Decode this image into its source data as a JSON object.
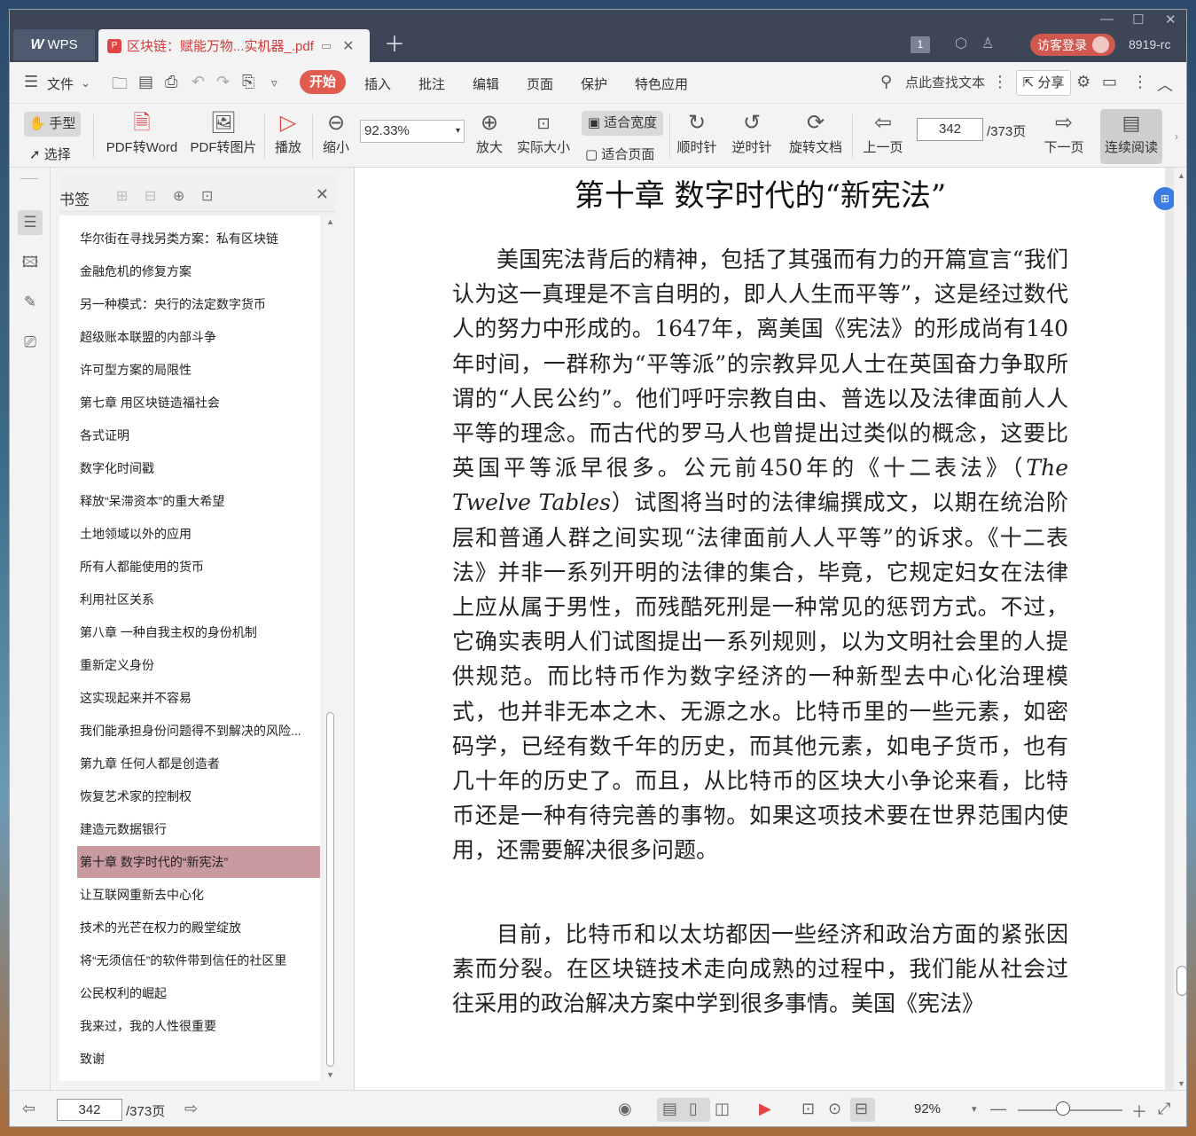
{
  "titlebar": {
    "app_name": "WPS",
    "doc_tab_title": "区块链：赋能万物...实机器_.pdf",
    "badge_count": "1",
    "login_label": "访客登录",
    "user_id": "8919-rc"
  },
  "menubar": {
    "file": "文件",
    "tabs": [
      "开始",
      "插入",
      "批注",
      "编辑",
      "页面",
      "保护",
      "特色应用"
    ],
    "search_placeholder": "点此查找文本",
    "share": "分享"
  },
  "toolbar": {
    "hand": "手型",
    "select": "选择",
    "pdf_to_word": "PDF转Word",
    "pdf_to_image": "PDF转图片",
    "play": "播放",
    "zoom_out": "缩小",
    "zoom_value": "92.33%",
    "zoom_in": "放大",
    "actual_size": "实际大小",
    "fit_width": "适合宽度",
    "fit_page": "适合页面",
    "clockwise": "顺时针",
    "counterclockwise": "逆时针",
    "rotate_doc": "旋转文档",
    "prev_page": "上一页",
    "page_current": "342",
    "page_total": "/373页",
    "next_page": "下一页",
    "continuous": "连续阅读"
  },
  "bookmarks": {
    "title": "书签",
    "items": [
      "华尔街在寻找另类方案：私有区块链",
      "金融危机的修复方案",
      "另一种模式：央行的法定数字货币",
      "超级账本联盟的内部斗争",
      "许可型方案的局限性",
      "第七章 用区块链造福社会",
      "各式证明",
      "数字化时间戳",
      "释放“呆滞资本”的重大希望",
      "土地领域以外的应用",
      "所有人都能使用的货币",
      "利用社区关系",
      "第八章 一种自我主权的身份机制",
      "重新定义身份",
      "这实现起来并不容易",
      "我们能承担身份问题得不到解决的风险...",
      "第九章 任何人都是创造者",
      "恢复艺术家的控制权",
      "建造元数据银行",
      "第十章 数字时代的“新宪法”",
      "让互联网重新去中心化",
      "技术的光芒在权力的殿堂绽放",
      "将“无须信任”的软件带到信任的社区里",
      "公民权利的崛起",
      "我来过，我的人性很重要",
      "致谢"
    ],
    "selected_index": 19
  },
  "document": {
    "chapter_title": "第十章 数字时代的“新宪法”",
    "para1_part1": "美国宪法背后的精神，包括了其强而有力的开篇宣言“我们认为这一真理是不言自明的，即人人生而平等”，这是经过数代人的努力中形成的。1647年，离美国《宪法》的形成尚有140年时间，一群称为“平等派”的宗教异见人士在英国奋力争取所谓的“人民公约”。他们呼吁宗教自由、普选以及法律面前人人平等的理念。而古代的罗马人也曾提出过类似的概念，这要比英国平等派早很多。公元前450年的《十二表法》（",
    "para1_italic": "The Twelve Tables",
    "para1_part2": "）试图将当时的法律编撰成文，以期在统治阶层和普通人群之间实现“法律面前人人平等”的诉求。《十二表法》并非一系列开明的法律的集合，毕竟，它规定妇女在法律上应从属于男性，而残酷死刑是一种常见的惩罚方式。不过，它确实表明人们试图提出一系列规则，以为文明社会里的人提供规范。而比特币作为数字经济的一种新型去中心化治理模式，也并非无本之木、无源之水。比特币里的一些元素，如密码学，已经有数千年的历史，而其他元素，如电子货币，也有几十年的历史了。而且，从比特币的区块大小争论来看，比特币还是一种有待完善的事物。如果这项技术要在世界范围内使用，还需要解决很多问题。",
    "para2": "目前，比特币和以太坊都因一些经济和政治方面的紧张因素而分裂。在区块链技术走向成熟的过程中，我们能从社会过往采用的政治解决方案中学到很多事情。美国《宪法》"
  },
  "statusbar": {
    "page_current": "342",
    "page_total": "/373页",
    "zoom": "92%"
  }
}
